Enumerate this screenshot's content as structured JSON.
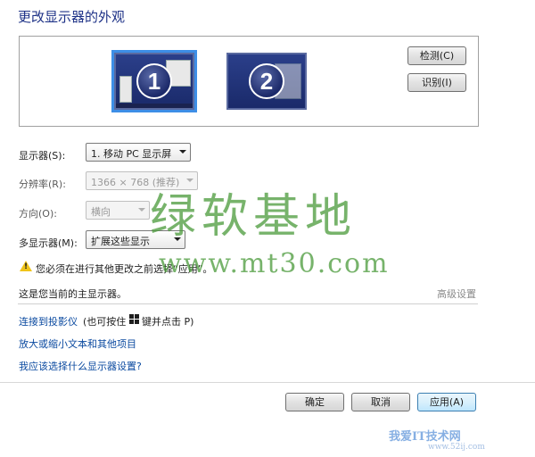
{
  "page": {
    "title": "更改显示器的外观"
  },
  "monitors": [
    {
      "number": "1"
    },
    {
      "number": "2"
    }
  ],
  "buttons": {
    "detect": "检测(C)",
    "identify": "识别(I)",
    "ok": "确定",
    "cancel": "取消",
    "apply": "应用(A)"
  },
  "settings": {
    "display_label": "显示器(S):",
    "display_value": "1. 移动 PC 显示屏",
    "resolution_label": "分辨率(R):",
    "resolution_value": "1366 × 768 (推荐)",
    "orientation_label": "方向(O):",
    "orientation_value": "横向",
    "multi_label": "多显示器(M):",
    "multi_value": "扩展这些显示"
  },
  "warning": "您必须在进行其他更改之前选择“应用”。",
  "main_display_text": "这是您当前的主显示器。",
  "advanced_link": "高级设置",
  "links": {
    "projector_a": "连接到投影仪",
    "projector_b": " (也可按住 ",
    "projector_c": " 键并点击 P)",
    "text_size": "放大或缩小文本和其他项目",
    "which_settings": "我应该选择什么显示器设置?"
  },
  "watermarks": {
    "main": "绿软基地",
    "url": "www.mt30.com",
    "corner": "我爱IT技术网",
    "corner_url": "www.52ij.com"
  },
  "colors": {
    "title": "#1e3287",
    "link": "#0b4aa0",
    "selection": "#3d8ee6",
    "watermark": "#4a9a3a"
  }
}
